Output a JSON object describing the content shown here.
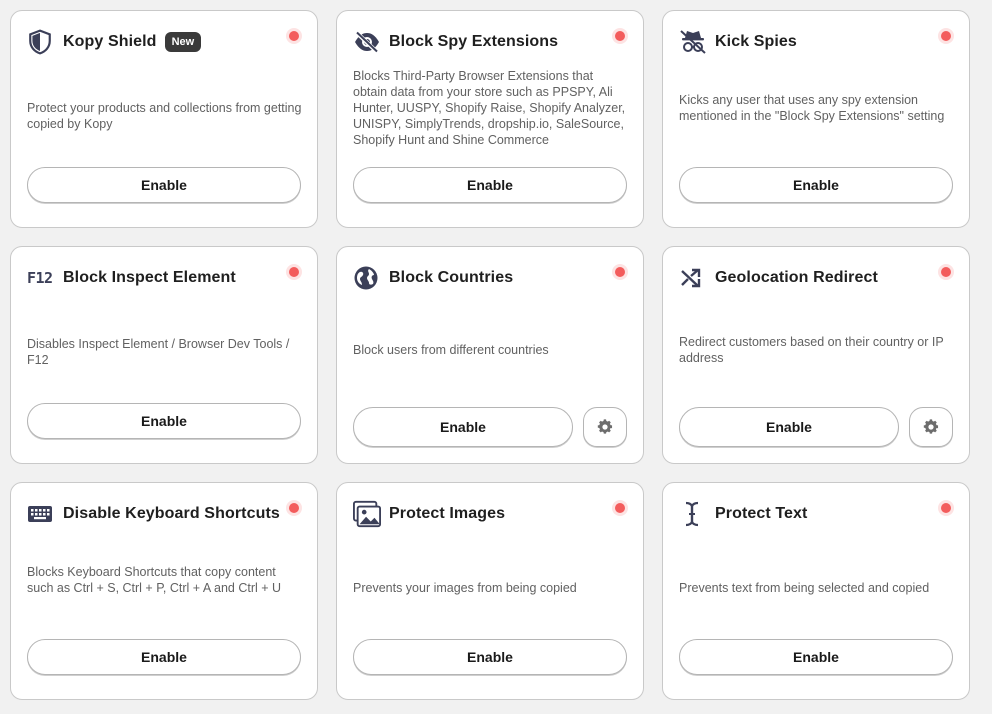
{
  "colors": {
    "status_dot": "#f35c5c",
    "icon": "#3b3f58"
  },
  "cards": [
    {
      "title": "Kopy Shield",
      "badge": "New",
      "icon": "shield-icon",
      "description": "Protect your products and collections from getting copied by Kopy",
      "button": "Enable"
    },
    {
      "title": "Block Spy Extensions",
      "icon": "eye-slash-icon",
      "description": "Blocks Third-Party Browser Extensions that obtain data from your store such as PPSPY, Ali Hunter, UUSPY, Shopify Raise, Shopify Analyzer, UNISPY, SimplyTrends, dropship.io, SaleSource, Shopify Hunt and Shine Commerce",
      "button": "Enable"
    },
    {
      "title": "Kick Spies",
      "icon": "spy-slash-icon",
      "description": "Kicks any user that uses any spy extension mentioned in the \"Block Spy Extensions\" setting",
      "button": "Enable"
    },
    {
      "title": "Block Inspect Element",
      "icon": "f12-icon",
      "icon_text": "F12",
      "description": "Disables Inspect Element / Browser Dev Tools / F12",
      "button": "Enable"
    },
    {
      "title": "Block Countries",
      "icon": "globe-icon",
      "description": "Block users from different countries",
      "button": "Enable",
      "has_settings": true
    },
    {
      "title": "Geolocation Redirect",
      "icon": "shuffle-icon",
      "description": "Redirect customers based on their country or IP address",
      "button": "Enable",
      "has_settings": true
    },
    {
      "title": "Disable Keyboard Shortcuts",
      "icon": "keyboard-icon",
      "description": "Blocks Keyboard Shortcuts that copy content such as Ctrl + S, Ctrl + P, Ctrl + A and Ctrl + U",
      "button": "Enable"
    },
    {
      "title": "Protect Images",
      "icon": "image-icon",
      "description": "Prevents your images from being copied",
      "button": "Enable"
    },
    {
      "title": "Protect Text",
      "icon": "text-cursor-icon",
      "description": "Prevents text from being selected and copied",
      "button": "Enable"
    }
  ]
}
